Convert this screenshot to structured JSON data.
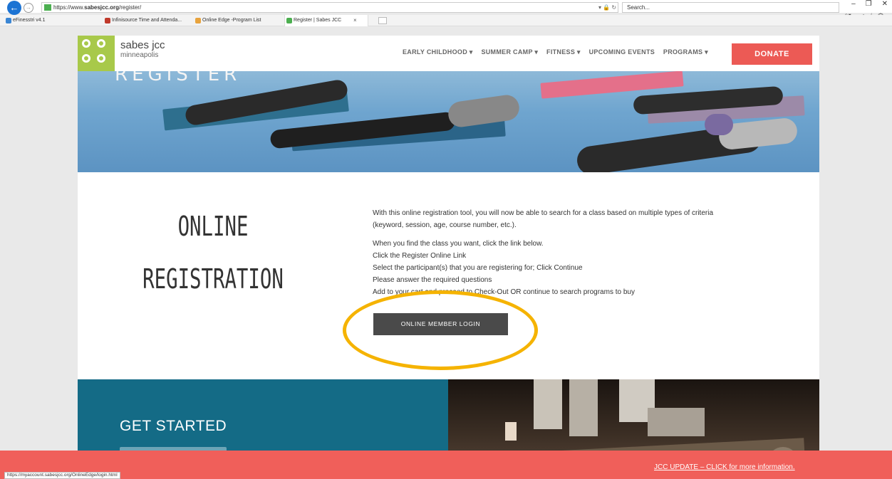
{
  "browser": {
    "url_prefix": "https://www.",
    "url_domain": "sabesjcc.org",
    "url_path": "/register/",
    "search_placeholder": "Search...",
    "window_controls": [
      "–",
      "❐",
      "✕"
    ],
    "tabs": [
      {
        "label": "eFinesstri v4.1",
        "icon_color": "#3a86d4"
      },
      {
        "label": "Infinisource Time and Attenda...",
        "icon_color": "#c0392b"
      },
      {
        "label": "Online Edge -Program List",
        "icon_color": "#e8a33d"
      },
      {
        "label": "Register | Sabes JCC",
        "icon_color": "#4caf50",
        "active": true
      }
    ],
    "tab_close": "×",
    "status_url": "https://myaccount.sabesjcc.org/OnlineEdge/login.html"
  },
  "header": {
    "logo_name": "sabes jcc",
    "logo_city": "minneapolis",
    "nav": [
      "EARLY CHILDHOOD ▾",
      "SUMMER CAMP ▾",
      "FITNESS ▾",
      "UPCOMING EVENTS",
      "PROGRAMS ▾"
    ],
    "donate_label": "DONATE"
  },
  "hero": {
    "word": "REGISTER"
  },
  "main": {
    "title_line1": "ONLINE",
    "title_line2": "REGISTRATION",
    "intro": "With this online registration tool, you will now be able to search for a class based on multiple types of criteria (keyword, session, age, course number, etc.).",
    "steps": [
      "When you find the class you want, click the link below.",
      "Click the Register Online Link",
      "Select the participant(s) that you are registering for; Click Continue",
      "Please answer the required questions",
      "Add to your cart and proceed to Check-Out OR continue to search programs to buy"
    ],
    "login_button": "ONLINE MEMBER LOGIN"
  },
  "get_started": {
    "heading": "GET STARTED"
  },
  "alert": {
    "link_text": "JCC UPDATE – CLICK for more information."
  },
  "colors": {
    "brand_green": "#a8c94a",
    "donate_red": "#ec5a55",
    "alert_red": "#f05f5a",
    "teal": "#146b86",
    "highlight": "#f5b300"
  }
}
